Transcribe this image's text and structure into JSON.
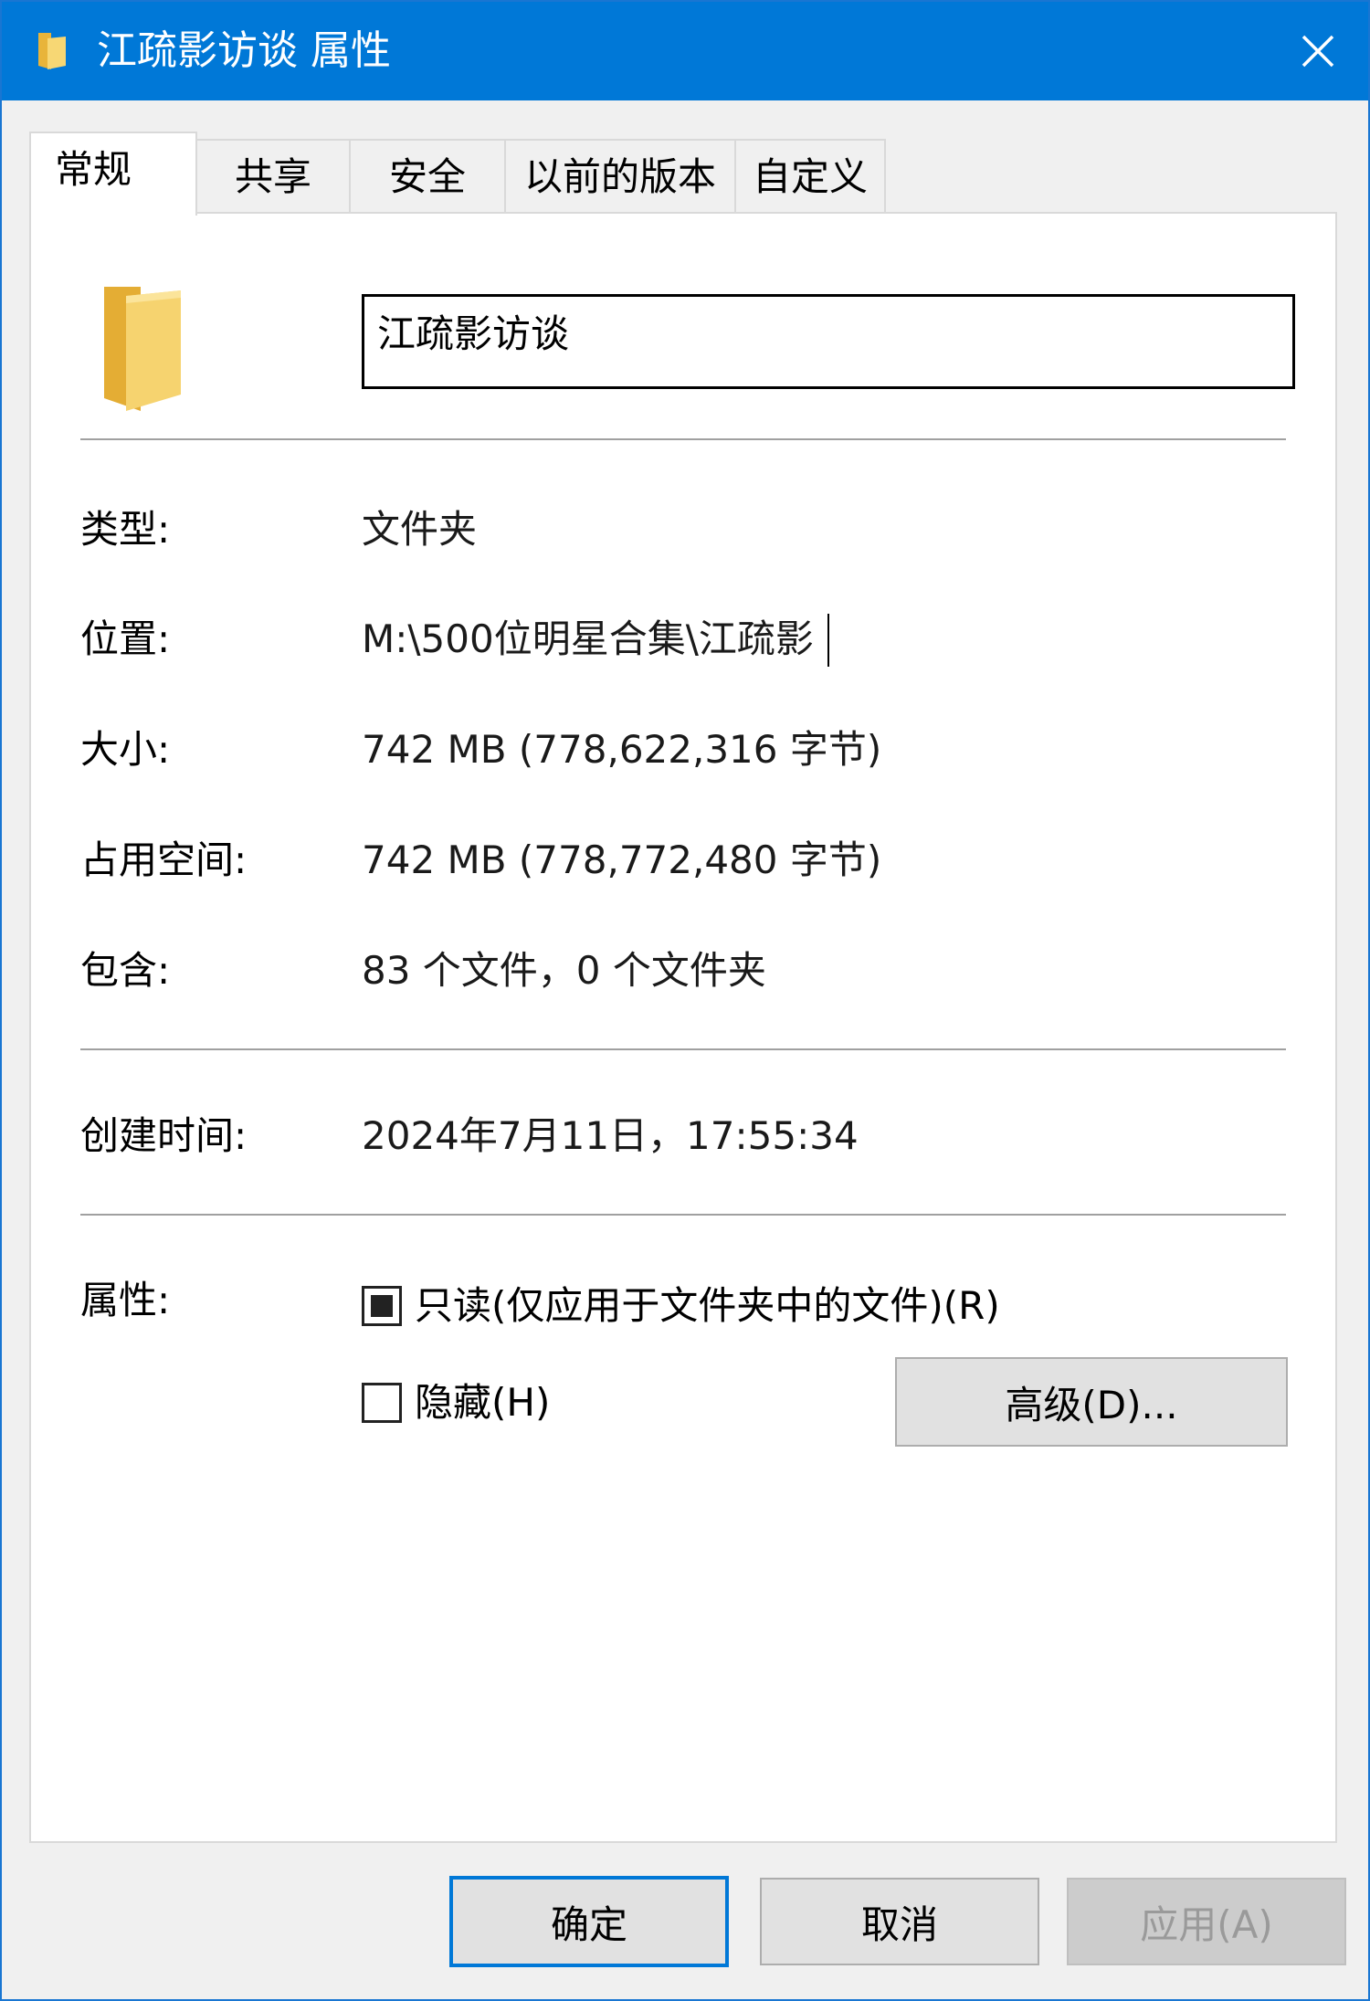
{
  "window": {
    "title": "江疏影访谈 属性"
  },
  "tabs": [
    {
      "label": "常规"
    },
    {
      "label": "共享"
    },
    {
      "label": "安全"
    },
    {
      "label": "以前的版本"
    },
    {
      "label": "自定义"
    }
  ],
  "general": {
    "name_value": "江疏影访谈",
    "type_label": "类型:",
    "type_value": "文件夹",
    "location_label": "位置:",
    "location_value": "M:\\500位明星合集\\江疏影",
    "size_label": "大小:",
    "size_value": "742 MB (778,622,316 字节)",
    "disk_label": "占用空间:",
    "disk_value": "742 MB (778,772,480 字节)",
    "contains_label": "包含:",
    "contains_value": "83 个文件，0 个文件夹",
    "created_label": "创建时间:",
    "created_value": "2024年7月11日，17:55:34",
    "attributes_label": "属性:",
    "readonly_label": "只读(仅应用于文件夹中的文件)(R)",
    "readonly_state": "indeterminate",
    "hidden_label": "隐藏(H)",
    "hidden_state": "unchecked",
    "advanced_button": "高级(D)..."
  },
  "footer": {
    "ok_label": "确定",
    "cancel_label": "取消",
    "apply_label": "应用(A)"
  },
  "colors": {
    "titlebar": "#0078d7",
    "focus_border": "#0078d7",
    "folder": "#f2c94c"
  },
  "icons": {
    "title": "folder-icon",
    "close": "close-icon",
    "folder_large": "folder-icon"
  }
}
